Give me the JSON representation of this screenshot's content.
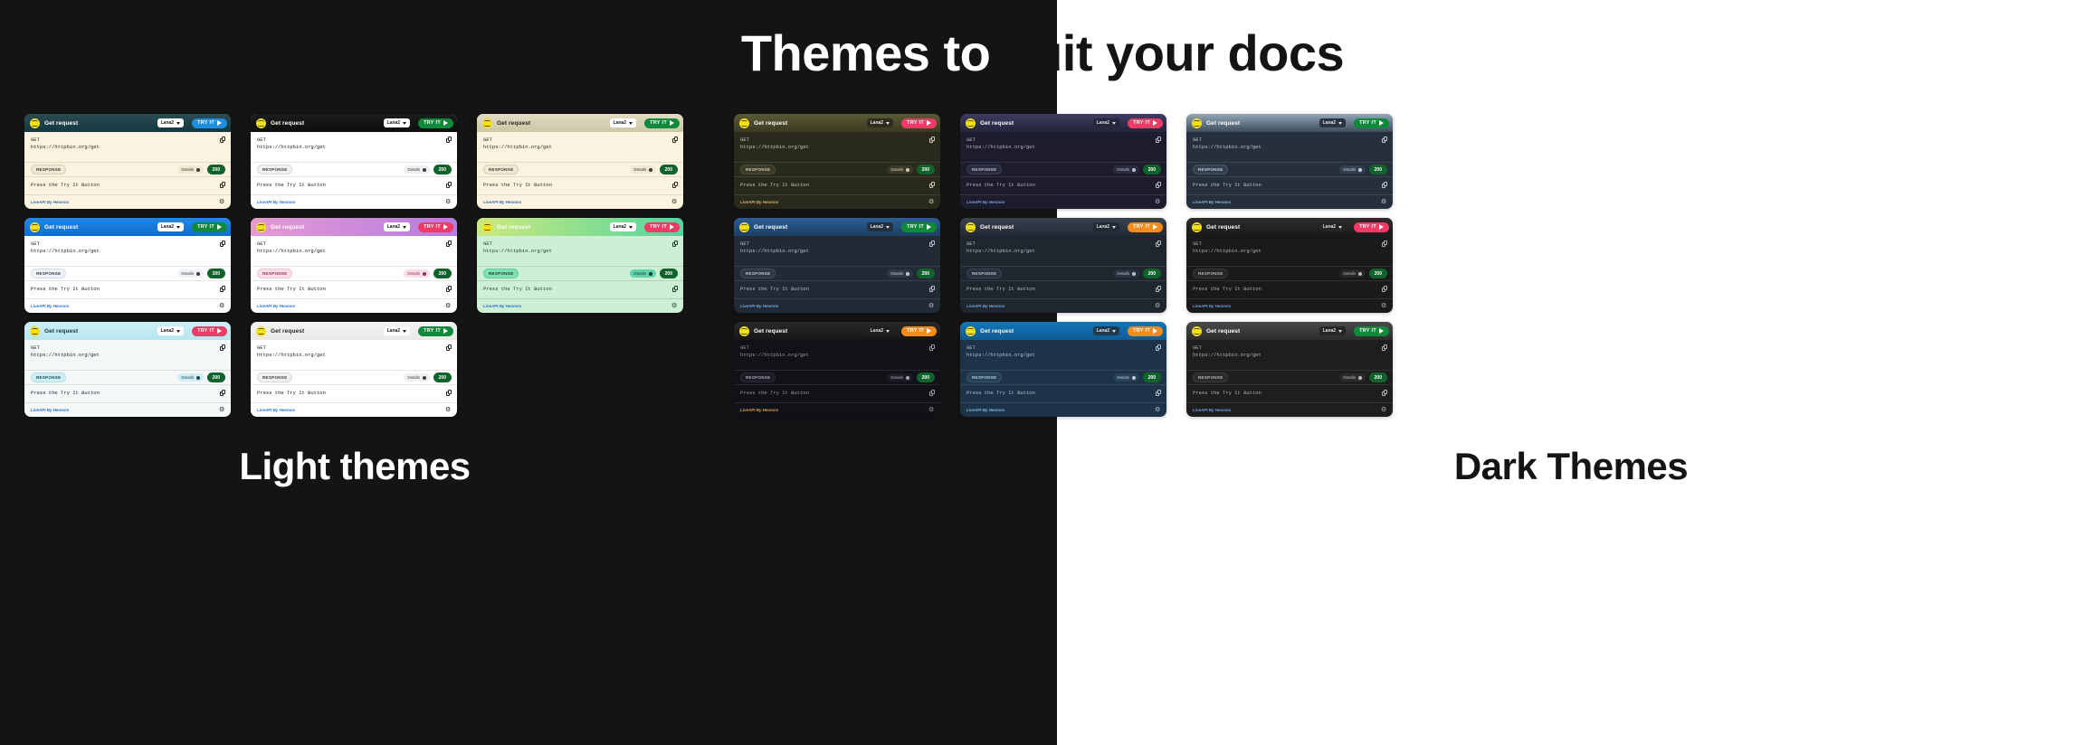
{
  "headline": {
    "part_light": "Themes to ",
    "part_dark": "suit your docs"
  },
  "captions": {
    "light": "Light themes",
    "dark": "Dark Themes"
  },
  "card_defaults": {
    "logo_name": "liveapi-logo-icon",
    "title": "Get request",
    "lang": "Lana2",
    "try_it": "TRY IT",
    "method": "GET",
    "url": "https://httpbin.org/get",
    "response_label": "RESPONSE",
    "details_label": "Details",
    "status_code": "200",
    "body_text": "Press the Try It Button",
    "footer_text": "LiveAPI By Hexmos",
    "copy_icon": "copy-icon",
    "gear_icon": "gear-icon",
    "caret_icon": "chevron-down-icon",
    "play_icon": "play-icon"
  },
  "light_themes": [
    {
      "id": "teal-dark-header",
      "head_bg": "linear-gradient(180deg,#2c4b52 0%,#123840 100%)",
      "head_fg": "#ffffff",
      "sel_bg": "#ffffff",
      "sel_fg": "#1b1b1b",
      "try_bg": "#1d8ee0",
      "body_bg": "#fbf3e0",
      "body_fg": "#2b2b24",
      "pill_bg": "#f0e8d2",
      "pill_fg": "#3a3a30",
      "pill_bd": "#d8cfb4",
      "det_bg": "#f0e8d2",
      "det_fg": "#3a3a30",
      "status_bg": "#11632c",
      "foot_fg": "#3a6ea8",
      "divider": "rgba(0,0,0,0.10)"
    },
    {
      "id": "black-header-white",
      "head_bg": "linear-gradient(180deg,#1d1d1d 0%,#0d0d0d 100%)",
      "head_fg": "#ffffff",
      "sel_bg": "#ffffff",
      "sel_fg": "#1b1b1b",
      "try_bg": "#108a3a",
      "body_bg": "#ffffff",
      "body_fg": "#23232a",
      "pill_bg": "#f0f0f0",
      "pill_fg": "#3a3a3a",
      "pill_bd": "#d9d9d9",
      "det_bg": "#efefef",
      "det_fg": "#3a3a3a",
      "status_bg": "#11632c",
      "foot_fg": "#2f6fd0",
      "divider": "rgba(0,0,0,0.10)"
    },
    {
      "id": "beige-cream",
      "head_bg": "linear-gradient(180deg,#e3dcc4 0%,#cdc5a6 100%)",
      "head_fg": "#22221c",
      "sel_bg": "#ffffff",
      "sel_fg": "#1b1b1b",
      "try_bg": "#108a3a",
      "body_bg": "#fbf3e0",
      "body_fg": "#2b2b24",
      "pill_bg": "#f0e8d2",
      "pill_fg": "#3a3a30",
      "pill_bd": "#d8cfb4",
      "det_bg": "#f0e8d2",
      "det_fg": "#3a3a30",
      "status_bg": "#11632c",
      "foot_fg": "#3a6ea8",
      "divider": "rgba(0,0,0,0.10)"
    },
    {
      "id": "blue-header",
      "head_bg": "linear-gradient(180deg,#2288e8 0%,#0d6ed0 100%)",
      "head_fg": "#ffffff",
      "sel_bg": "#ffffff",
      "sel_fg": "#1b1b1b",
      "try_bg": "#108a3a",
      "body_bg": "#ffffff",
      "body_fg": "#23232a",
      "pill_bg": "#eef2f7",
      "pill_fg": "#3a3a3a",
      "pill_bd": "#d6dde6",
      "det_bg": "#eef2f7",
      "det_fg": "#3a3a3a",
      "status_bg": "#11632c",
      "foot_fg": "#2f6fd0",
      "divider": "rgba(0,0,0,0.10)"
    },
    {
      "id": "pink-purple-gradient",
      "head_bg": "linear-gradient(100deg,#e79ad4 0%,#b47ce0 100%)",
      "head_fg": "#ffffff",
      "sel_bg": "#ffffff",
      "sel_fg": "#1b1b1b",
      "try_bg": "#ef3b66",
      "body_bg": "#ffffff",
      "body_fg": "#23232a",
      "pill_bg": "#fbdde6",
      "pill_fg": "#8c3550",
      "pill_bd": "#f3c4d2",
      "det_bg": "#fbdde6",
      "det_fg": "#8c3550",
      "status_bg": "#11632c",
      "foot_fg": "#2f6fd0",
      "divider": "rgba(0,0,0,0.10)"
    },
    {
      "id": "green-mint-gradient",
      "head_bg": "linear-gradient(100deg,#cfe97c 0%,#4fd6a0 100%)",
      "head_fg": "#ffffff",
      "sel_bg": "#ffffff",
      "sel_fg": "#1b1b1b",
      "try_bg": "#ef3b66",
      "body_bg": "#cdf0d4",
      "body_fg": "#1e3a27",
      "pill_bg": "#7fe0b4",
      "pill_fg": "#15412c",
      "pill_bd": "#63cf9e",
      "det_bg": "#5fd3aa",
      "det_fg": "#123a27",
      "status_bg": "#11632c",
      "foot_fg": "#2f6fd0",
      "divider": "rgba(0,0,0,0.12)"
    },
    {
      "id": "cyan-light",
      "head_bg": "linear-gradient(180deg,#cdeef5 0%,#b7e6f0 100%)",
      "head_fg": "#16343c",
      "sel_bg": "#ffffff",
      "sel_fg": "#1b1b1b",
      "try_bg": "#ef3b66",
      "body_bg": "#f4f8f9",
      "body_fg": "#23232a",
      "pill_bg": "#cfeef4",
      "pill_fg": "#1b4750",
      "pill_bd": "#b3e2ea",
      "det_bg": "#cfeef4",
      "det_fg": "#1b4750",
      "status_bg": "#11632c",
      "foot_fg": "#2f6fd0",
      "divider": "rgba(0,0,0,0.10)"
    },
    {
      "id": "plain-grey-white",
      "head_bg": "linear-gradient(180deg,#f3f3f3 0%,#e9e9e9 100%)",
      "head_fg": "#23232a",
      "sel_bg": "#ffffff",
      "sel_fg": "#1b1b1b",
      "try_bg": "#108a3a",
      "body_bg": "#ffffff",
      "body_fg": "#23232a",
      "pill_bg": "#f0f0f0",
      "pill_fg": "#3a3a3a",
      "pill_bd": "#dadada",
      "det_bg": "#efefef",
      "det_fg": "#3a3a3a",
      "status_bg": "#11632c",
      "foot_fg": "#2f6fd0",
      "divider": "rgba(0,0,0,0.10)"
    }
  ],
  "dark_themes": [
    {
      "id": "olive-dark",
      "head_bg": "linear-gradient(180deg,#5a5936 0%,#3a3a22 100%)",
      "head_fg": "#ffffff",
      "sel_bg": "#2c2c1f",
      "sel_fg": "#e8e8dc",
      "try_bg": "#ef3b66",
      "body_bg": "#2a2a1c",
      "body_fg": "#c9c9b4",
      "pill_bg": "#3a3a28",
      "pill_fg": "#cfcfb8",
      "pill_bd": "#4c4c35",
      "det_bg": "#3a3a28",
      "det_fg": "#cfcfb8",
      "status_bg": "#11632c",
      "foot_fg": "#d0b26a",
      "divider": "rgba(255,255,255,0.10)"
    },
    {
      "id": "indigo-dark",
      "head_bg": "linear-gradient(180deg,#3c3c60 0%,#24243c 100%)",
      "head_fg": "#ffffff",
      "sel_bg": "#26263a",
      "sel_fg": "#dcdcea",
      "try_bg": "#ef3b66",
      "body_bg": "#1c1c2c",
      "body_fg": "#b8b8cc",
      "pill_bg": "#2a2a40",
      "pill_fg": "#c2c2d6",
      "pill_bd": "#3b3b55",
      "det_bg": "#2a2a40",
      "det_fg": "#c2c2d6",
      "status_bg": "#11632c",
      "foot_fg": "#7b9de0",
      "divider": "rgba(255,255,255,0.10)"
    },
    {
      "id": "steel-blue-dark",
      "head_bg": "linear-gradient(180deg,#93a7b8 0%,#3c4c5c 100%)",
      "head_fg": "#ffffff",
      "sel_bg": "#2a3340",
      "sel_fg": "#dbe3ec",
      "try_bg": "#108a3a",
      "body_bg": "#26303c",
      "body_fg": "#bcc7d2",
      "pill_bg": "#32404f",
      "pill_fg": "#c6d2de",
      "pill_bd": "#455667",
      "det_bg": "#32404f",
      "det_fg": "#c6d2de",
      "status_bg": "#11632c",
      "foot_fg": "#7fb0e0",
      "divider": "rgba(255,255,255,0.10)"
    },
    {
      "id": "navy-blue-header",
      "head_bg": "linear-gradient(180deg,#2a5f96 0%,#1d3f63 100%)",
      "head_fg": "#ffffff",
      "sel_bg": "#24303e",
      "sel_fg": "#d8e2ec",
      "try_bg": "#108a3a",
      "body_bg": "#222a36",
      "body_fg": "#b6c0cc",
      "pill_bg": "#2e3846",
      "pill_fg": "#c0cad6",
      "pill_bd": "#3f4c5c",
      "det_bg": "#2e3846",
      "det_fg": "#c0cad6",
      "status_bg": "#11632c",
      "foot_fg": "#6fa8e0",
      "divider": "rgba(255,255,255,0.10)"
    },
    {
      "id": "slate-orange-cta",
      "head_bg": "linear-gradient(180deg,#3a4250 0%,#242a34 100%)",
      "head_fg": "#ffffff",
      "sel_bg": "#242a34",
      "sel_fg": "#dbe0e8",
      "try_bg": "#f28c1b",
      "body_bg": "#1f2630",
      "body_fg": "#b4bcc8",
      "pill_bg": "#2b323e",
      "pill_fg": "#bcc4d0",
      "pill_bd": "#3c4552",
      "det_bg": "#2b323e",
      "det_fg": "#bcc4d0",
      "status_bg": "#11632c",
      "foot_fg": "#6fa8e0",
      "divider": "rgba(255,255,255,0.10)"
    },
    {
      "id": "charcoal-dark",
      "head_bg": "linear-gradient(180deg,#2d2d2d 0%,#1a1a1a 100%)",
      "head_fg": "#ffffff",
      "sel_bg": "#242424",
      "sel_fg": "#e0e0e0",
      "try_bg": "#ef3b66",
      "body_bg": "#1a1a1a",
      "body_fg": "#b0b0b0",
      "pill_bg": "#272727",
      "pill_fg": "#bababa",
      "pill_bd": "#383838",
      "det_bg": "#272727",
      "det_fg": "#bababa",
      "status_bg": "#11632c",
      "foot_fg": "#6f9ce0",
      "divider": "rgba(255,255,255,0.10)"
    },
    {
      "id": "deep-black-orange",
      "head_bg": "linear-gradient(180deg,#2a2a2a 0%,#151515 100%)",
      "head_fg": "#ffffff",
      "sel_bg": "#202020",
      "sel_fg": "#dedede",
      "try_bg": "#f28c1b",
      "body_bg": "#111118",
      "body_fg": "#9a9aa6",
      "pill_bg": "#1c1c26",
      "pill_fg": "#a8a8b4",
      "pill_bd": "#2c2c38",
      "det_bg": "#1c1c26",
      "det_fg": "#a8a8b4",
      "status_bg": "#11632c",
      "foot_fg": "#d0a24a",
      "divider": "rgba(255,255,255,0.10)"
    },
    {
      "id": "ocean-blue-dark",
      "head_bg": "linear-gradient(180deg,#1476b8 0%,#0d5b92 100%)",
      "head_fg": "#ffffff",
      "sel_bg": "#20394c",
      "sel_fg": "#d8e6f0",
      "try_bg": "#f28c1b",
      "body_bg": "#1d3448",
      "body_fg": "#b0c2d2",
      "pill_bg": "#274157",
      "pill_fg": "#bccdda",
      "pill_bd": "#365569",
      "det_bg": "#274157",
      "det_fg": "#bccdda",
      "status_bg": "#11632c",
      "foot_fg": "#77b4e8",
      "divider": "rgba(255,255,255,0.10)"
    },
    {
      "id": "graphite-grey",
      "head_bg": "linear-gradient(180deg,#4a4a4a 0%,#2c2c2c 100%)",
      "head_fg": "#ffffff",
      "sel_bg": "#262626",
      "sel_fg": "#e0e0e0",
      "try_bg": "#108a3a",
      "body_bg": "#1e1e1e",
      "body_fg": "#b4b4b4",
      "pill_bg": "#2b2b2b",
      "pill_fg": "#bebebe",
      "pill_bd": "#3c3c3c",
      "det_bg": "#2b2b2b",
      "det_fg": "#bebebe",
      "status_bg": "#11632c",
      "foot_fg": "#6f9ce0",
      "divider": "rgba(255,255,255,0.10)"
    }
  ]
}
